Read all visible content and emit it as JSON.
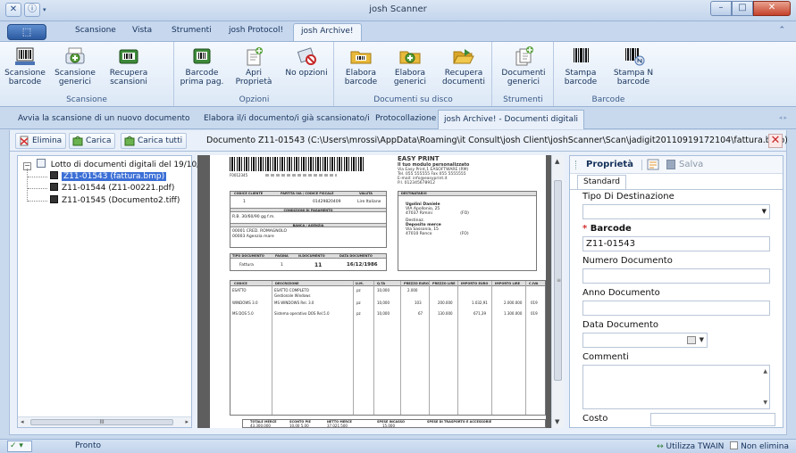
{
  "window": {
    "title": "josh Scanner"
  },
  "ribbon_tabs": [
    "Scansione",
    "Vista",
    "Strumenti",
    "josh Protocol!",
    "josh Archive!"
  ],
  "ribbon": {
    "groups": [
      {
        "label": "Scansione",
        "buttons": [
          {
            "line1": "Scansione",
            "line2": "barcode",
            "icon": "barcode-scan-icon"
          },
          {
            "line1": "Scansione",
            "line2": "generici",
            "icon": "scan-add-icon"
          },
          {
            "line1": "Recupera",
            "line2": "scansioni",
            "icon": "scanner-icon"
          }
        ]
      },
      {
        "label": "Opzioni",
        "buttons": [
          {
            "line1": "Barcode",
            "line2": "prima pag.",
            "icon": "barcode-first-page-icon"
          },
          {
            "line1": "Apri",
            "line2": "Proprietà",
            "icon": "properties-icon"
          },
          {
            "line1": "No opzioni",
            "line2": "",
            "icon": "no-options-icon"
          }
        ]
      },
      {
        "label": "Documenti su disco",
        "buttons": [
          {
            "line1": "Elabora",
            "line2": "barcode",
            "icon": "folder-barcode-icon"
          },
          {
            "line1": "Elabora",
            "line2": "generici",
            "icon": "folder-add-icon"
          },
          {
            "line1": "Recupera",
            "line2": "documenti",
            "icon": "folder-open-icon"
          }
        ]
      },
      {
        "label": "Strumenti",
        "buttons": [
          {
            "line1": "Documenti",
            "line2": "generici",
            "icon": "documents-icon"
          }
        ]
      },
      {
        "label": "Barcode",
        "buttons": [
          {
            "line1": "Stampa",
            "line2": "barcode",
            "icon": "print-barcode-icon"
          },
          {
            "line1": "Stampa N",
            "line2": "barcode",
            "icon": "print-n-barcode-icon"
          }
        ]
      }
    ]
  },
  "subtabs": [
    "Avvia la scansione di un nuovo documento",
    "Elabora il/i documento/i già scansionato/i",
    "Protocollazione",
    "josh Archive! - Documenti digitali"
  ],
  "toolbar": {
    "delete": "Elimina",
    "load": "Carica",
    "load_all": "Carica tutti",
    "document_path": "Documento Z11-01543 (C:\\Users\\mrossi\\AppData\\Roaming\\it Consult\\josh Client\\joshScanner\\Scan\\jadigit20110919172104\\fattura.bmp)"
  },
  "tree": {
    "root": "Lotto di documenti digitali del 19/10/2",
    "items": [
      "Z11-01543 (fattura.bmp)",
      "Z11-01544 (Z11-00221.pdf)",
      "Z11-01545 (Documento2.tiff)"
    ],
    "scroll_glyph": "III"
  },
  "invoice": {
    "company": {
      "name": "EASY PRINT",
      "lines": [
        "Il tuo modulo personalizzato",
        "Via Easy Print,1 EASOFTWARE (RM)",
        "Tel. 055 555555   Fax 055 5555555",
        "E-mail:    info@easyprint.it",
        "P.I.  012345678912"
      ]
    },
    "barcode_number": "F0012345",
    "customer_box": {
      "headers": [
        "CODICE CLIENTE",
        "PARTITA IVA / CODICE FISCALE",
        "VALUTA"
      ],
      "values": [
        "1",
        "01429820409",
        "Lire Italiane"
      ],
      "payment_header": "CONDIZIONI DI PAGAMENTO",
      "payment": "R.B. 30/60/90 gg f.m.",
      "bank_header": "BANCA / AGENZIA",
      "bank_lines": [
        "00001 CRED. ROMAGNOLO",
        "00003 Agenzia mare"
      ]
    },
    "doc_box": {
      "headers": [
        "TIPO DOCUMENTO",
        "PAGINA",
        "N.DOCUMENTO",
        "DATA DOCUMENTO"
      ],
      "values": [
        "Fattura",
        "1",
        "11",
        "16/12/1986"
      ]
    },
    "recipient": {
      "header": "DESTINATARIO",
      "lines": [
        "Ugolini Daniele",
        "VIA Apollonio, 25",
        "47037 Rimini",
        "(FO)",
        "Destinaz.",
        "Deposito merce",
        "Via Sassonia, 15",
        "47010 Ronco",
        "(FO)"
      ]
    },
    "items_headers": [
      "CODICE",
      "DESCRIZIONE",
      "U.M.",
      "Q.TA",
      "PREZZO EURO",
      "PREZZO LIRE",
      "IMPORTO EURO",
      "IMPORTO LIRE",
      "C.IVA"
    ],
    "items": [
      [
        "ESATTO",
        "ESATTO COMPLETO",
        "pz",
        "10,000",
        "2.000",
        "",
        "",
        "",
        ""
      ],
      [
        "",
        "Gestionale Windows",
        "",
        "",
        "",
        "",
        "",
        "",
        ""
      ],
      [
        "WINDOWS 3.0",
        "MS WINDOWS Rel. 3.0",
        "pz",
        "10,000",
        "103",
        "200.000",
        "1.032,91",
        "2.000.000",
        "019"
      ],
      [
        "MS DOS 5.0",
        "Sistema operativo DOS Rel.5.0",
        "pz",
        "10,000",
        "67",
        "130.000",
        "671,39",
        "1.300.000",
        "019"
      ]
    ],
    "totals_headers": [
      "TOTALE MERCE",
      "SCONTO PIE",
      "NETTO MERCE",
      "SPESE INCASSO",
      "SPESE DI TRASPORTO E ACCESSORIE"
    ],
    "totals_values": [
      "43.300.000",
      "10,00 5,00",
      "37.021.500",
      "15.000",
      ""
    ]
  },
  "properties": {
    "title": "Proprietà",
    "save": "Salva",
    "tab": "Standard",
    "fields": {
      "tipo_destinazione": {
        "label": "Tipo Di Destinazione",
        "value": ""
      },
      "barcode": {
        "label": "Barcode",
        "value": "Z11-01543"
      },
      "numero_documento": {
        "label": "Numero Documento",
        "value": ""
      },
      "anno_documento": {
        "label": "Anno Documento",
        "value": ""
      },
      "data_documento": {
        "label": "Data Documento",
        "value": ""
      },
      "commenti": {
        "label": "Commenti",
        "value": ""
      },
      "costo": {
        "label": "Costo",
        "value": ""
      }
    }
  },
  "status": {
    "text": "Pronto",
    "twain": "Utilizza TWAIN",
    "no_delete": "Non elimina"
  }
}
